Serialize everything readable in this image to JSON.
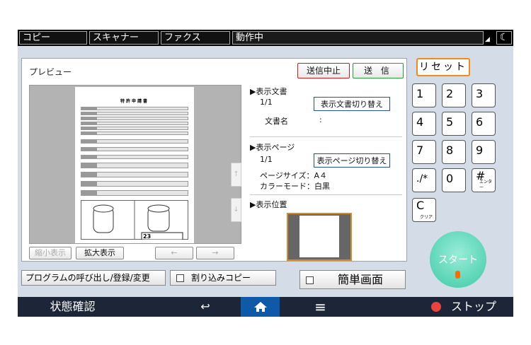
{
  "topbar": {
    "tabs": [
      "コピー",
      "スキャナー",
      "ファクス",
      "動作中"
    ],
    "moon_icon": "moon-icon",
    "triangle_icon": "corner-triangle-icon"
  },
  "panel": {
    "title": "プレビュー",
    "cancel_label": "送信中止",
    "send_label": "送 信",
    "shrink_label": "縮小表示",
    "zoom_label": "拡大表示",
    "prev_arrow": "←",
    "next_arrow": "→",
    "scroll_up": "↑",
    "scroll_down": "↓"
  },
  "doc": {
    "title": "特許申請書",
    "page_badge": "23"
  },
  "info": {
    "doc_section": "▶表示文書",
    "doc_count": "1/1",
    "doc_switch_label": "表示文書切り替え",
    "doc_name_label": "文書名",
    "doc_name_value": ":",
    "page_section": "▶表示ページ",
    "page_count": "1/1",
    "page_switch_label": "表示ページ切り替え",
    "page_size": "ページサイズ：A４",
    "color_mode": "カラーモード：白黒",
    "position_section": "▶表示位置"
  },
  "keypad": {
    "reset_label": "リセット",
    "keys": [
      "1",
      "2",
      "3",
      "4",
      "5",
      "6",
      "7",
      "8",
      "9",
      "./*",
      "0",
      "#"
    ],
    "enter_sub": "エンター",
    "clear_key": "C",
    "clear_sub": "クリア",
    "start_label": "スタート"
  },
  "bottom": {
    "program_label": "プログラムの呼び出し/登録/変更",
    "interrupt_label": "割り込みコピー",
    "simple_label": "簡単画面"
  },
  "navbar": {
    "status_label": "状態確認",
    "back_icon": "↩",
    "home_icon": "home-icon",
    "menu_icon": "≡",
    "stop_label": "ストップ"
  },
  "colors": {
    "nav_bg": "#1c2638",
    "home_bg": "#0f5aa8",
    "reset_border": "#ef8a1d",
    "start": "#3ecaa6",
    "stop": "#e8433e"
  }
}
